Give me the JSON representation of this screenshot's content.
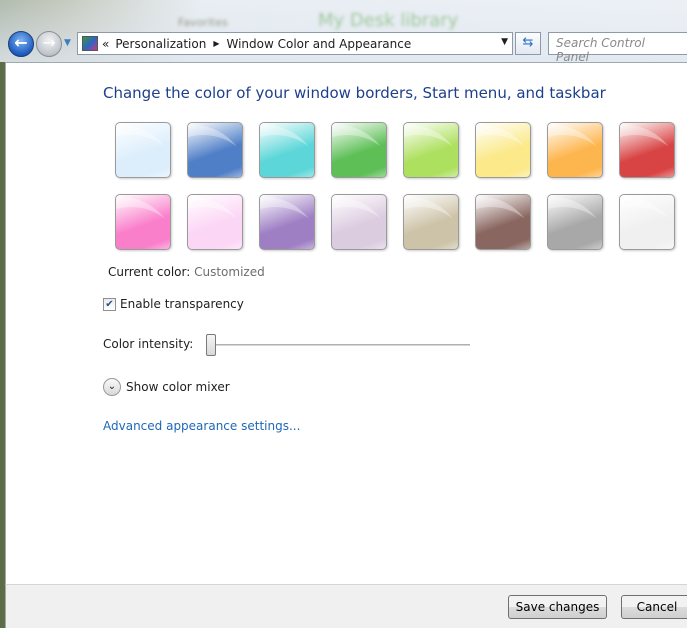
{
  "nav": {
    "back_icon": "back-arrow-icon",
    "forward_icon": "forward-arrow-icon",
    "overflow": "«",
    "breadcrumb": [
      "Personalization",
      "Window Color and Appearance"
    ],
    "search_placeholder": "Search Control Panel"
  },
  "background": {
    "blurred_title": "My Desk library",
    "blurred_favorites": "Favorites"
  },
  "page": {
    "title": "Change the color of your window borders, Start menu, and taskbar",
    "swatches": [
      "#dceefc",
      "#4f7fc7",
      "#5cd6d8",
      "#5dbf56",
      "#aee060",
      "#fbe98a",
      "#fdb54d",
      "#d84444",
      "#fa7fcb",
      "#fcd6f5",
      "#9e7fc4",
      "#dccce0",
      "#cdc3a8",
      "#8a6660",
      "#a8a8a8",
      "#f0f0f0"
    ],
    "current_color_label": "Current color:",
    "current_color_value": "Customized",
    "transparency_label": "Enable transparency",
    "transparency_checked": true,
    "intensity_label": "Color intensity:",
    "intensity_value_percent": 0,
    "mixer_label": "Show color mixer",
    "advanced_link": "Advanced appearance settings..."
  },
  "footer": {
    "save": "Save changes",
    "cancel": "Cancel"
  }
}
